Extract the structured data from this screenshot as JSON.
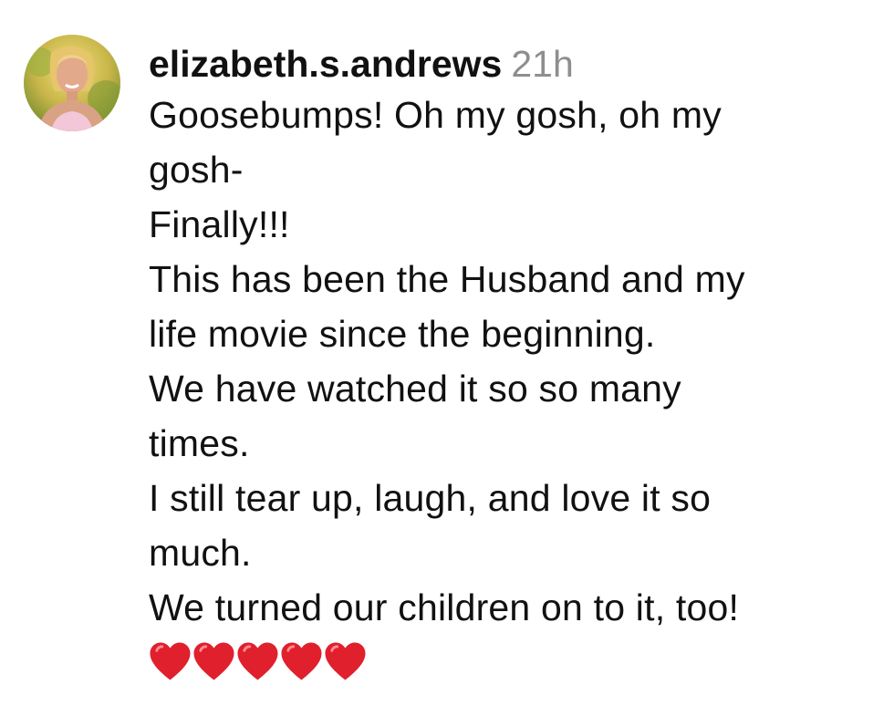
{
  "comment": {
    "username": "elizabeth.s.andrews",
    "timestamp": "21h",
    "lines": [
      "Goosebumps! Oh my gosh, oh my",
      "gosh-",
      "Finally!!!",
      "This has been the Husband and my",
      "life movie since the beginning.",
      "We have watched it so so many",
      "times.",
      "I still tear up, laugh, and love it so",
      "much.",
      "We turned our children on to it, too!"
    ],
    "emoji": {
      "icon": "red-heart",
      "count": 5,
      "color": "#e0202d"
    }
  },
  "colors": {
    "text": "#111111",
    "timestamp": "#8e8e8e",
    "background": "#ffffff"
  }
}
